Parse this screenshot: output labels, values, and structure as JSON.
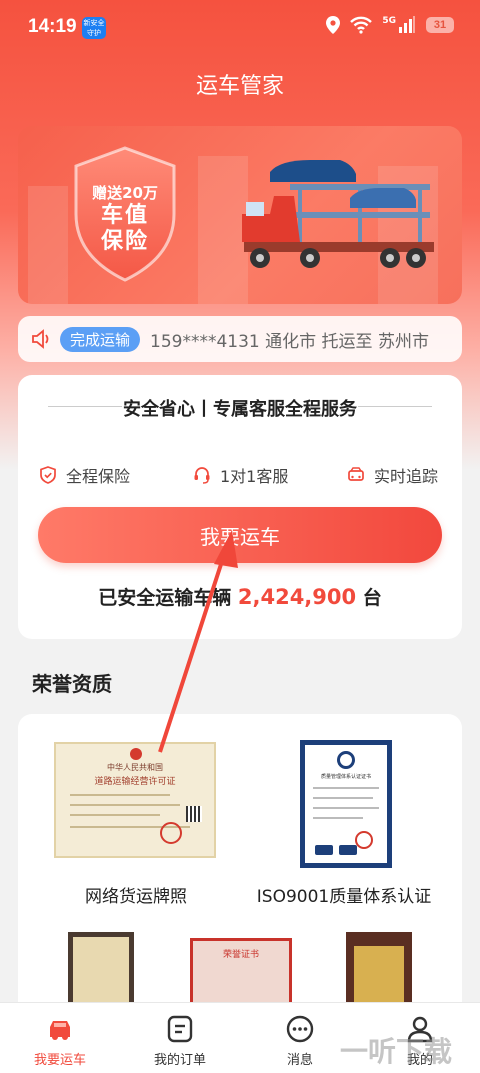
{
  "status_bar": {
    "time": "14:19",
    "app_badge": "新安全守护",
    "network": "5G",
    "battery": "31"
  },
  "header": {
    "title": "运车管家"
  },
  "banner": {
    "gift_line": "赠送20万",
    "line1": "车值",
    "line2": "保险"
  },
  "ticker": {
    "badge": "完成运输",
    "message": "159****4131 通化市 托运至 苏州市"
  },
  "service": {
    "heading": "安全省心丨专属客服全程服务",
    "features": [
      {
        "icon": "shield-check-icon",
        "label": "全程保险"
      },
      {
        "icon": "headset-icon",
        "label": "1对1客服"
      },
      {
        "icon": "car-track-icon",
        "label": "实时追踪"
      }
    ],
    "ship_button": "我要运车",
    "stat_prefix": "已安全运输车辆",
    "stat_number": "2,424,900",
    "stat_suffix": "台"
  },
  "honors": {
    "title": "荣誉资质",
    "items": [
      {
        "caption": "网络货运牌照",
        "cert_title": "中华人民共和国",
        "cert_subtitle": "道路运输经营许可证"
      },
      {
        "caption": "ISO9001质量体系认证",
        "cert_title": "质量管理体系认证证书"
      }
    ],
    "row2_labels": [
      "荣誉证书"
    ]
  },
  "nav": {
    "items": [
      {
        "label": "我要运车",
        "icon": "car-icon",
        "active": true
      },
      {
        "label": "我的订单",
        "icon": "order-icon",
        "active": false
      },
      {
        "label": "消息",
        "icon": "message-icon",
        "active": false
      },
      {
        "label": "我的",
        "icon": "user-icon",
        "active": false
      }
    ]
  },
  "watermark": "一听下载",
  "colors": {
    "primary": "#f14a3c",
    "badge_blue": "#5b9ff5",
    "bg": "#f2f2f2"
  }
}
